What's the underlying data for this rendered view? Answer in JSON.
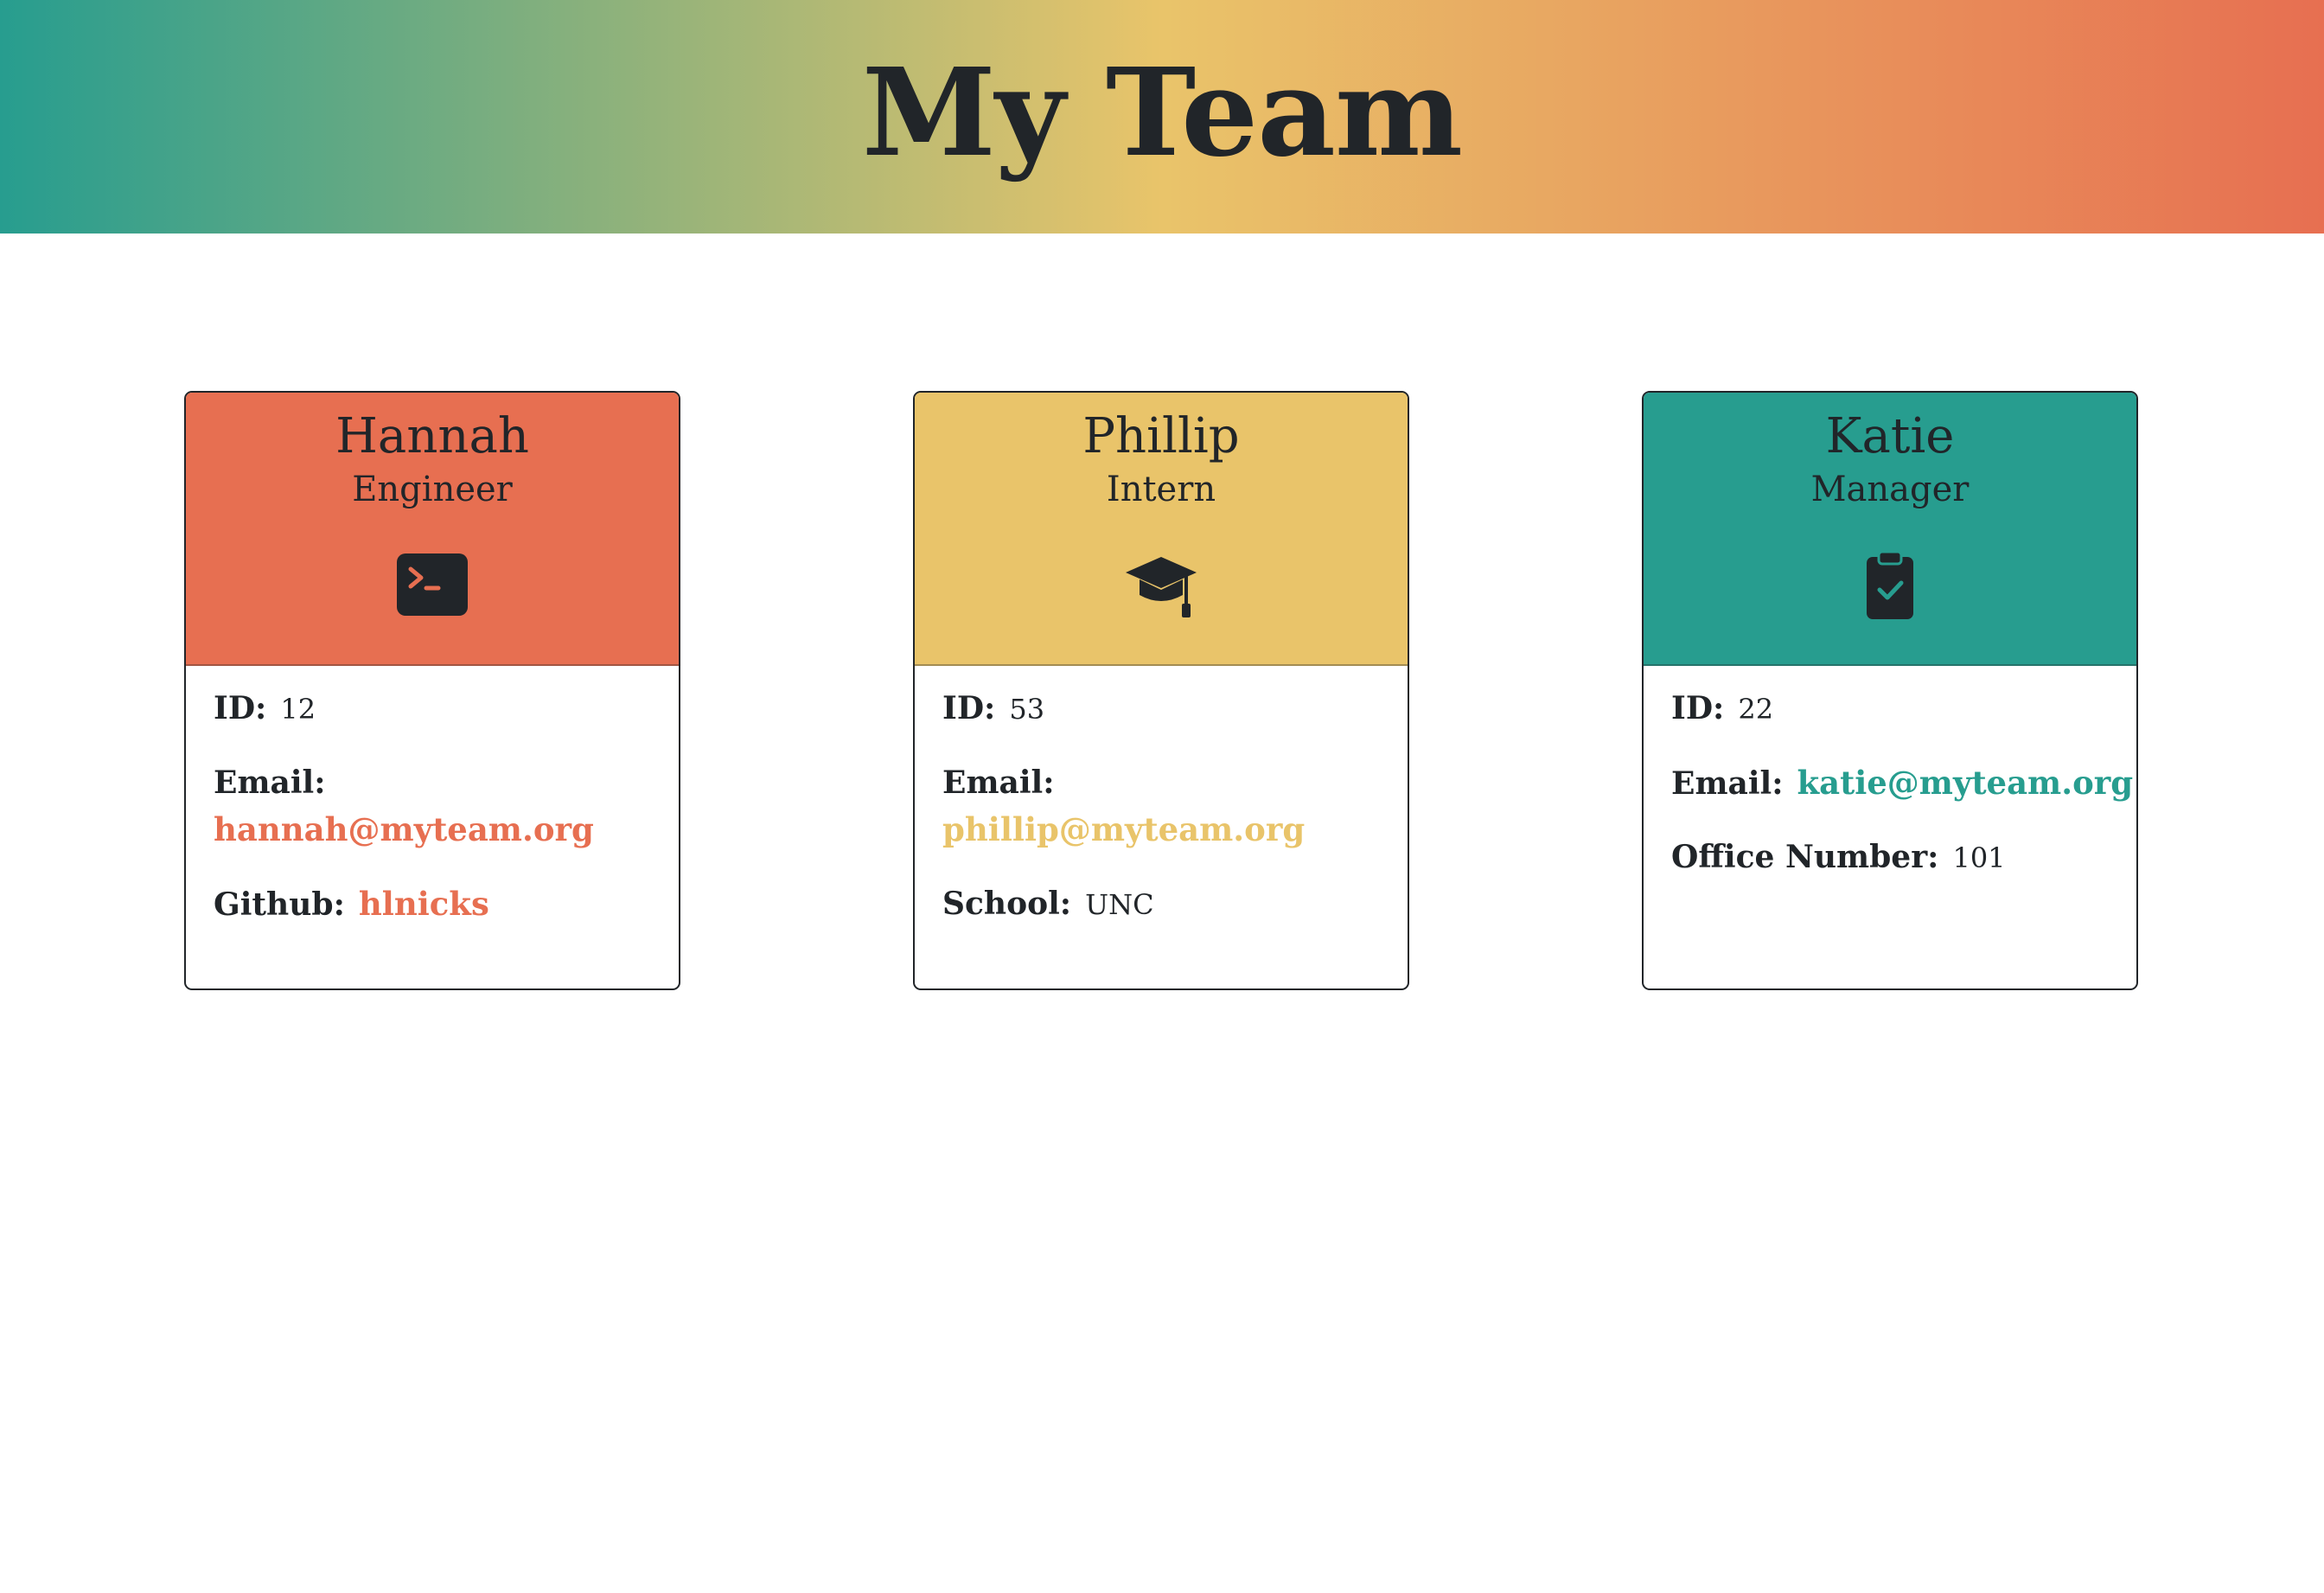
{
  "page": {
    "title": "My Team"
  },
  "colors": {
    "engineer": "#e76f51",
    "intern": "#e9c46a",
    "manager": "#279d8f",
    "text": "#212529"
  },
  "cards": [
    {
      "name": "Hannah",
      "role": "Engineer",
      "icon": "terminal-icon",
      "id_label": "ID:",
      "id": "12",
      "email_label": "Email:",
      "email": "hannah@myteam.org",
      "extra_label": "Github:",
      "extra_value": "hlnicks"
    },
    {
      "name": "Phillip",
      "role": "Intern",
      "icon": "graduation-cap-icon",
      "id_label": "ID:",
      "id": "53",
      "email_label": "Email:",
      "email": "phillip@myteam.org",
      "extra_label": "School:",
      "extra_value": "UNC"
    },
    {
      "name": "Katie",
      "role": "Manager",
      "icon": "clipboard-check-icon",
      "id_label": "ID:",
      "id": "22",
      "email_label": "Email:",
      "email": "katie@myteam.org",
      "extra_label": "Office Number:",
      "extra_value": "101"
    }
  ]
}
